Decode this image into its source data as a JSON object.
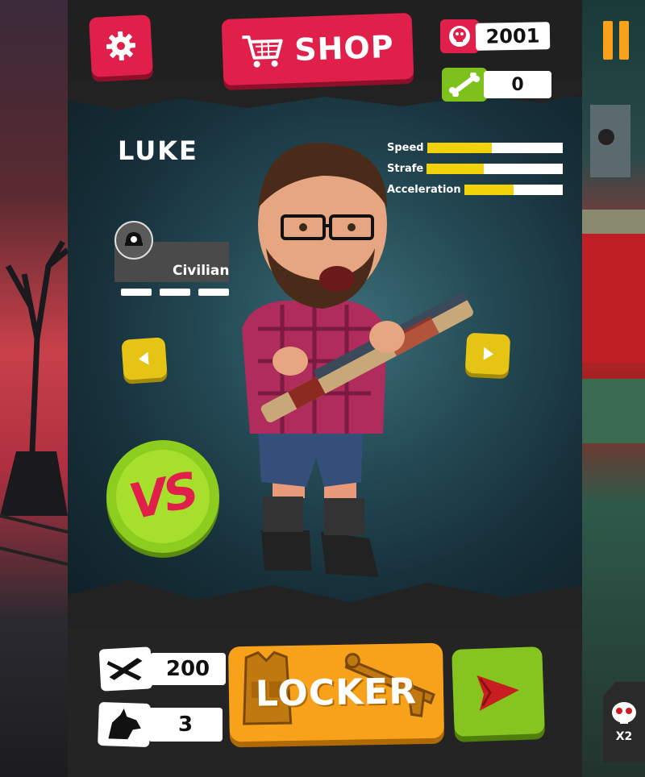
{
  "header": {
    "shop_label": "SHOP",
    "skulls": "2001",
    "bones": "0"
  },
  "character": {
    "name": "LUKE",
    "class_label": "Civilian",
    "stats": [
      {
        "label": "Speed",
        "level": 0.48
      },
      {
        "label": "Strafe",
        "level": 0.42
      },
      {
        "label": "Acceleration",
        "level": 0.5
      }
    ]
  },
  "vs_label": "VS",
  "footer": {
    "weapon_count": "200",
    "zombie_count": "3",
    "locker_label": "LOCKER"
  },
  "right_panel": {
    "multiplier_label": "X2"
  },
  "colors": {
    "red": "#e0204a",
    "green": "#86c51f",
    "yellow": "#e5c416",
    "orange": "#f8a11a",
    "stat_fill": "#f2d20a"
  },
  "icons": [
    "gear-icon",
    "cart-icon",
    "skull-icon",
    "bone-icon",
    "left-arrow-icon",
    "right-arrow-icon",
    "rifle-icon",
    "unicorn-icon",
    "vest-icon",
    "shotgun-icon",
    "video-play-icon",
    "pause-icon"
  ]
}
